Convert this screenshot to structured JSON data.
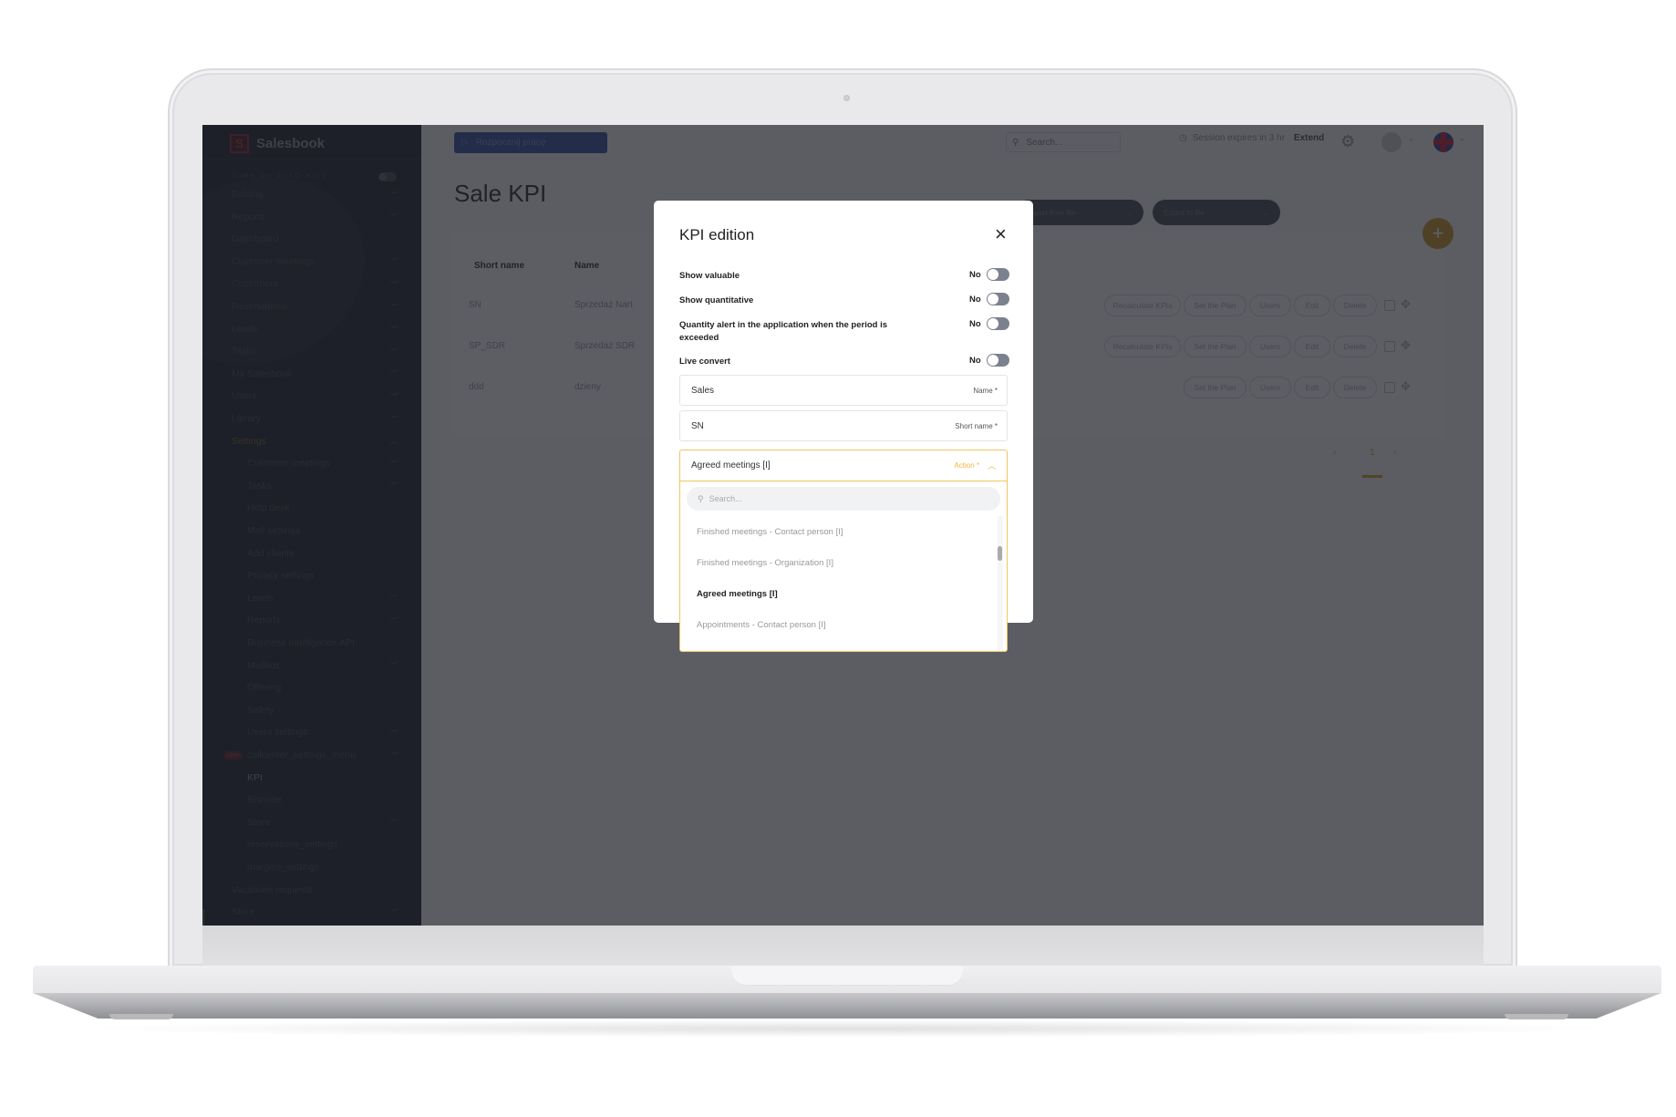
{
  "app": {
    "logo_letter": "S",
    "name": "Salesbook",
    "autohide_label": "TURN ON AUTO-HIDE",
    "start_button": "Rozpocznij pracę",
    "search_placeholder": "Search...",
    "session_text": "Session expires in 3 hr",
    "extend_label": "Extend",
    "language": "EN"
  },
  "sidebar": {
    "items": [
      {
        "label": "Bidding",
        "level": 0,
        "chevron": "down"
      },
      {
        "label": "Reports",
        "level": 0,
        "chevron": "down"
      },
      {
        "label": "Dashboard",
        "level": 0,
        "chevron": ""
      },
      {
        "label": "Customer meetings",
        "level": 0,
        "chevron": "down"
      },
      {
        "label": "Customers",
        "level": 0,
        "chevron": "down"
      },
      {
        "label": "Reservations",
        "level": 0,
        "chevron": "down"
      },
      {
        "label": "Leads",
        "level": 0,
        "chevron": "down"
      },
      {
        "label": "Tasks",
        "level": 0,
        "chevron": "down"
      },
      {
        "label": "My Salesbook",
        "level": 0,
        "chevron": "down"
      },
      {
        "label": "Users",
        "level": 0,
        "chevron": "down"
      },
      {
        "label": "Library",
        "level": 0,
        "chevron": "down"
      },
      {
        "label": "Settings",
        "level": 0,
        "chevron": "up",
        "state": "active"
      },
      {
        "label": "Customer meetings",
        "level": 1,
        "chevron": "down"
      },
      {
        "label": "Tasks",
        "level": 1,
        "chevron": "down"
      },
      {
        "label": "Help desk",
        "level": 1,
        "chevron": ""
      },
      {
        "label": "Mail settings",
        "level": 1,
        "chevron": ""
      },
      {
        "label": "Add clients",
        "level": 1,
        "chevron": ""
      },
      {
        "label": "Privacy settings",
        "level": 1,
        "chevron": ""
      },
      {
        "label": "Leads",
        "level": 1,
        "chevron": "down"
      },
      {
        "label": "Reports",
        "level": 1,
        "chevron": "down"
      },
      {
        "label": "Business Intelligence API",
        "level": 1,
        "chevron": ""
      },
      {
        "label": "Mailbox",
        "level": 1,
        "chevron": "down"
      },
      {
        "label": "Offering",
        "level": 1,
        "chevron": ""
      },
      {
        "label": "Safety",
        "level": 1,
        "chevron": ""
      },
      {
        "label": "Users settings",
        "level": 1,
        "chevron": "down"
      },
      {
        "label": "callcenter_settings_menu",
        "level": 1,
        "chevron": "down",
        "badge": "new"
      },
      {
        "label": "KPI",
        "level": 1,
        "chevron": "",
        "state": "current"
      },
      {
        "label": "Bisnode",
        "level": 1,
        "chevron": ""
      },
      {
        "label": "Store",
        "level": 1,
        "chevron": "down"
      },
      {
        "label": "reservations_settings",
        "level": 1,
        "chevron": ""
      },
      {
        "label": "margins_settings",
        "level": 1,
        "chevron": ""
      },
      {
        "label": "Vacations requests",
        "level": 0,
        "chevron": ""
      },
      {
        "label": "Store",
        "level": 0,
        "chevron": "down"
      }
    ]
  },
  "page": {
    "title": "Sale KPI",
    "import_label": "Import from file",
    "export_label": "Export to file",
    "table": {
      "columns": [
        "Short name",
        "Name"
      ],
      "rows": [
        {
          "short": "SN",
          "name": "Sprzedaż Nart",
          "actions": [
            "Recalculate KPIs",
            "Set the Plan",
            "Users",
            "Edit",
            "Delete"
          ]
        },
        {
          "short": "SP_SDR",
          "name": "Sprzedaż SDR",
          "actions": [
            "Recalculate KPIs",
            "Set the Plan",
            "Users",
            "Edit",
            "Delete"
          ]
        },
        {
          "short": "ddd",
          "name": "dzieny",
          "actions": [
            "Set the Plan",
            "Users",
            "Edit",
            "Delete"
          ]
        }
      ]
    },
    "pagination": {
      "prev": "‹",
      "current": "1",
      "next": "›"
    }
  },
  "modal": {
    "title": "KPI edition",
    "close_icon": "×",
    "options": [
      {
        "label": "Show valuable",
        "value": "No",
        "on": false
      },
      {
        "label": "Show quantitative",
        "value": "No",
        "on": false
      },
      {
        "label": "Quantity alert in the application when the period is exceeded",
        "value": "No",
        "on": false
      },
      {
        "label": "Live convert",
        "value": "No",
        "on": false
      }
    ],
    "name_field": {
      "value": "Sales",
      "label": "Name *"
    },
    "short_name_field": {
      "value": "SN",
      "label": "Short name *"
    },
    "action_select": {
      "value": "Agreed meetings [I]",
      "label": "Action *",
      "search_placeholder": "Search...",
      "options": [
        {
          "label": "Finished meetings - Contact person [I]",
          "selected": false
        },
        {
          "label": "Finished meetings - Organization [I]",
          "selected": false
        },
        {
          "label": "Agreed meetings [I]",
          "selected": true
        },
        {
          "label": "Appointments - Contact person [I]",
          "selected": false
        }
      ]
    }
  }
}
